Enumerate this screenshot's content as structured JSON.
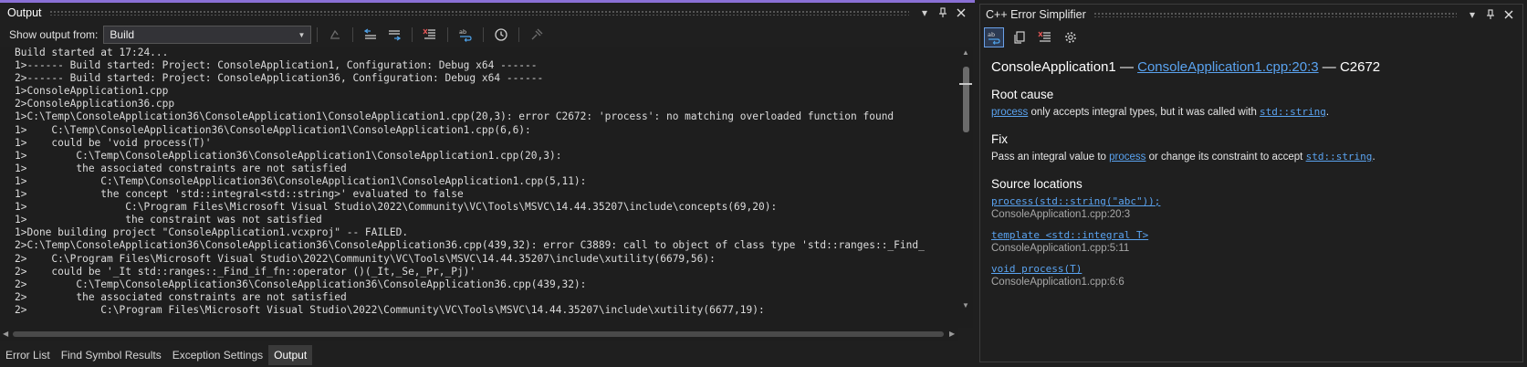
{
  "output_panel": {
    "title": "Output",
    "show_output_label": "Show output from:",
    "source_selected": "Build",
    "lines": [
      "Build started at 17:24...",
      "1>------ Build started: Project: ConsoleApplication1, Configuration: Debug x64 ------",
      "2>------ Build started: Project: ConsoleApplication36, Configuration: Debug x64 ------",
      "1>ConsoleApplication1.cpp",
      "2>ConsoleApplication36.cpp",
      "1>C:\\Temp\\ConsoleApplication36\\ConsoleApplication1\\ConsoleApplication1.cpp(20,3): error C2672: 'process': no matching overloaded function found",
      "1>    C:\\Temp\\ConsoleApplication36\\ConsoleApplication1\\ConsoleApplication1.cpp(6,6):",
      "1>    could be 'void process(T)'",
      "1>        C:\\Temp\\ConsoleApplication36\\ConsoleApplication1\\ConsoleApplication1.cpp(20,3):",
      "1>        the associated constraints are not satisfied",
      "1>            C:\\Temp\\ConsoleApplication36\\ConsoleApplication1\\ConsoleApplication1.cpp(5,11):",
      "1>            the concept 'std::integral<std::string>' evaluated to false",
      "1>                C:\\Program Files\\Microsoft Visual Studio\\2022\\Community\\VC\\Tools\\MSVC\\14.44.35207\\include\\concepts(69,20):",
      "1>                the constraint was not satisfied",
      "1>Done building project \"ConsoleApplication1.vcxproj\" -- FAILED.",
      "2>C:\\Temp\\ConsoleApplication36\\ConsoleApplication36\\ConsoleApplication36.cpp(439,32): error C3889: call to object of class type 'std::ranges::_Find_",
      "2>    C:\\Program Files\\Microsoft Visual Studio\\2022\\Community\\VC\\Tools\\MSVC\\14.44.35207\\include\\xutility(6679,56):",
      "2>    could be '_It std::ranges::_Find_if_fn::operator ()(_It,_Se,_Pr,_Pj)'",
      "2>        C:\\Temp\\ConsoleApplication36\\ConsoleApplication36\\ConsoleApplication36.cpp(439,32):",
      "2>        the associated constraints are not satisfied",
      "2>            C:\\Program Files\\Microsoft Visual Studio\\2022\\Community\\VC\\Tools\\MSVC\\14.44.35207\\include\\xutility(6677,19):"
    ],
    "bottom_tabs": [
      {
        "label": "Error List"
      },
      {
        "label": "Find Symbol Results"
      },
      {
        "label": "Exception Settings"
      },
      {
        "label": "Output",
        "active": true
      }
    ]
  },
  "error_simplifier": {
    "title": "C++ Error Simplifier",
    "heading": {
      "project": "ConsoleApplication1",
      "sep": "—",
      "location_link": "ConsoleApplication1.cpp:20:3",
      "code": "C2672"
    },
    "root_cause": {
      "title": "Root cause",
      "link1": "process",
      "text1": " only accepts integral types, but it was called with ",
      "link2": "std::string",
      "text2": "."
    },
    "fix": {
      "title": "Fix",
      "text1": "Pass an integral value to ",
      "link1": "process",
      "text2": " or change its constraint to accept ",
      "link2": "std::string",
      "text3": "."
    },
    "source_locations": {
      "title": "Source locations",
      "items": [
        {
          "code": "process(std::string(\"abc\"));",
          "file": "ConsoleApplication1.cpp:20:3"
        },
        {
          "code": "template <std::integral T>",
          "file": "ConsoleApplication1.cpp:5:11"
        },
        {
          "code": "void process(T)",
          "file": "ConsoleApplication1.cpp:6:6"
        }
      ]
    }
  },
  "colors": {
    "accent": "#8a70d6",
    "link": "#5aa3f0",
    "background": "#1f1f1f"
  },
  "icons": {
    "title_buttons": [
      "chevron-down-icon",
      "pin-icon",
      "close-icon"
    ],
    "output_tools": [
      "goto-location-icon",
      "prev-message-icon",
      "next-message-icon",
      "clear-all-icon",
      "word-wrap-icon",
      "timestamp-icon",
      "pin-tool-icon"
    ],
    "simplifier_tools": [
      "word-wrap-icon",
      "copy-icon",
      "clear-icon",
      "settings-icon"
    ]
  }
}
